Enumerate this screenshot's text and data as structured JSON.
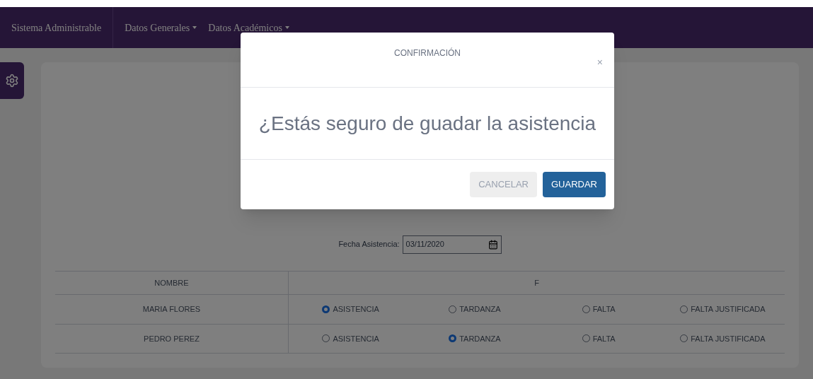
{
  "navbar": {
    "brand": "Sistema Administrable",
    "menus": [
      {
        "label": "Datos Generales"
      },
      {
        "label": "Datos Académicos"
      }
    ]
  },
  "form": {
    "date_label": "Fecha Asistencia:",
    "date_value": "03/11/2020"
  },
  "table": {
    "columns": [
      "NOMBRE",
      "F"
    ],
    "rows": [
      {
        "name": "MARIA FLORES",
        "choices": [
          {
            "label": "ASISTENCIA",
            "selected": true
          },
          {
            "label": "TARDANZA",
            "selected": false
          },
          {
            "label": "FALTA",
            "selected": false
          },
          {
            "label": "FALTA JUSTIFICADA",
            "selected": false
          }
        ]
      },
      {
        "name": "PEDRO PEREZ",
        "choices": [
          {
            "label": "ASISTENCIA",
            "selected": false
          },
          {
            "label": "TARDANZA",
            "selected": true
          },
          {
            "label": "FALTA",
            "selected": false
          },
          {
            "label": "FALTA JUSTIFICADA",
            "selected": false
          }
        ]
      }
    ]
  },
  "dialog": {
    "title": "CONFIRMACIÓN",
    "close": "×",
    "message": "¿Estás seguro de guadar la asistencia",
    "buttons": [
      {
        "label": "CANCELAR",
        "kind": "secondary"
      },
      {
        "label": "GUARDAR",
        "kind": "primary"
      }
    ]
  }
}
